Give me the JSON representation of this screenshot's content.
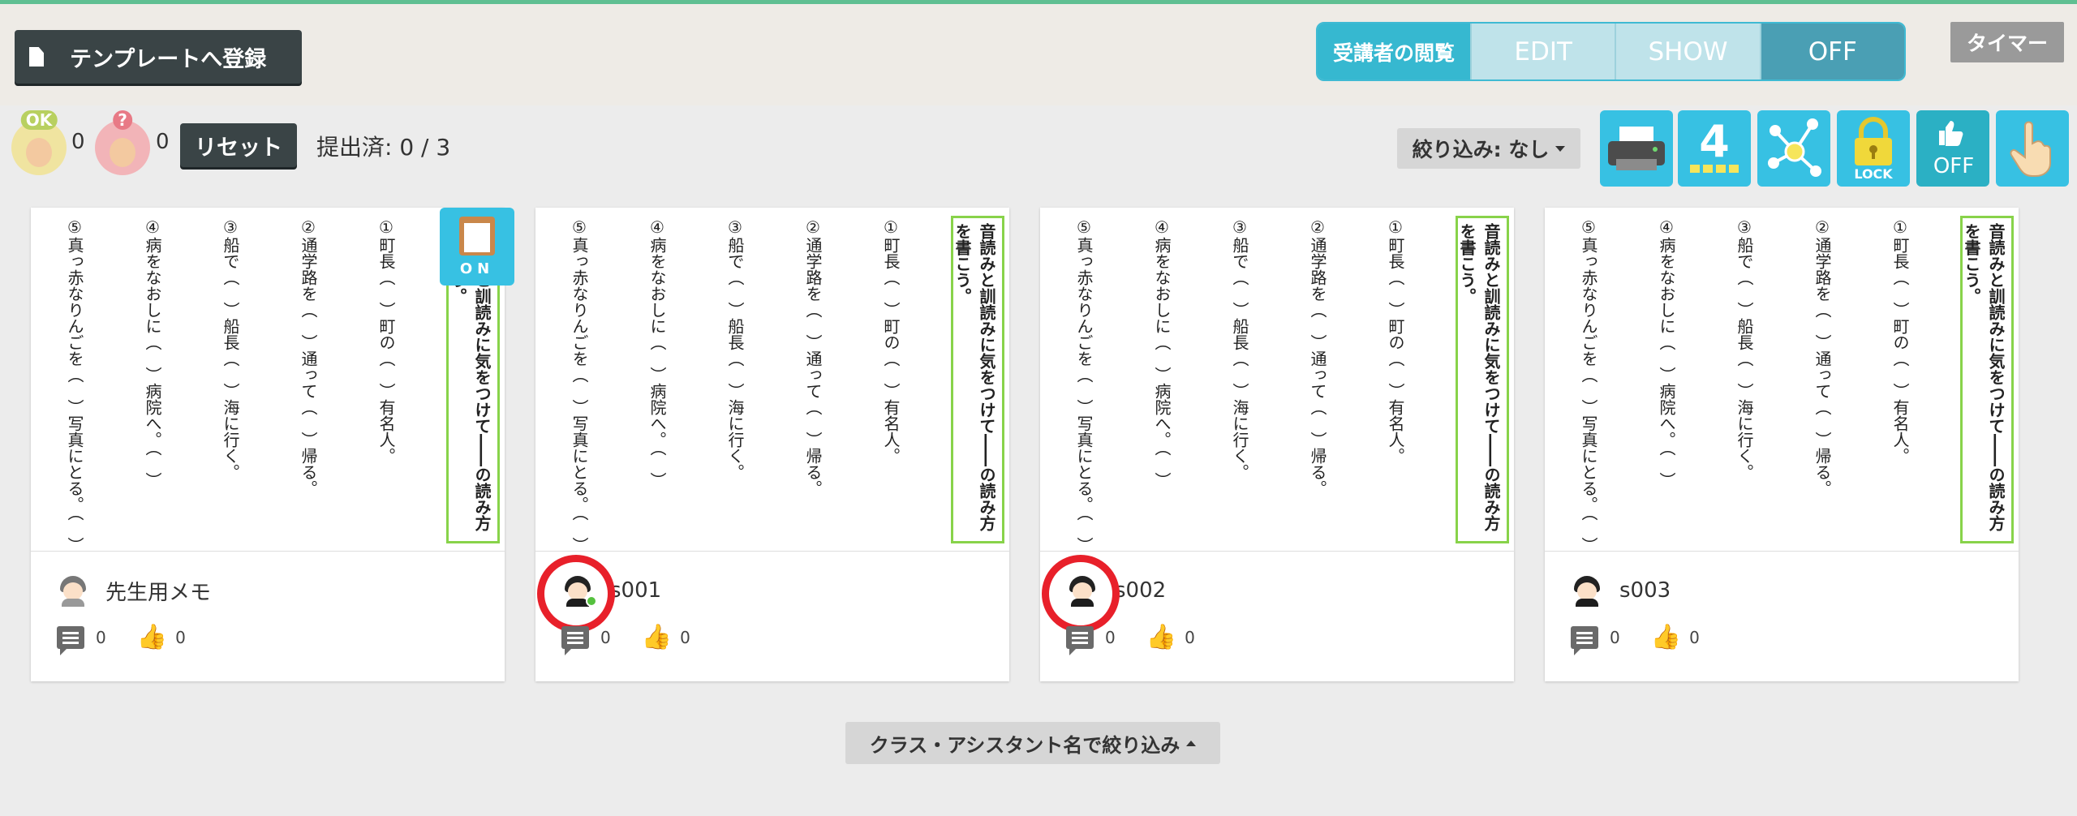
{
  "header": {
    "template_button": "テンプレートへ登録",
    "viewer_label": "受講者の閲覧",
    "view_modes": [
      "EDIT",
      "SHOW",
      "OFF"
    ],
    "selected_mode": "OFF",
    "timer": "タイマー"
  },
  "status": {
    "ok_tag": "OK",
    "ok_count": "0",
    "ng_tag": "?",
    "ng_count": "0",
    "reset": "リセット",
    "submitted": "提出済: 0 / 3",
    "filter": "絞り込み: なし"
  },
  "toolbar": {
    "tools": [
      "printer-icon",
      "layout-4-icon",
      "network-icon",
      "lock-icon",
      "like-off-icon",
      "hand-pointer-icon"
    ],
    "four_label": "4",
    "lock_label": "LOCK",
    "off_label": "OFF"
  },
  "sheet": {
    "title": "音読みと訓読みに気をつけて――の読み方を書こう。",
    "questions": [
      {
        "num": "①",
        "text": "町長（　）町の（　）有名人。"
      },
      {
        "num": "②",
        "text": "通学路を（　）通って（　）帰る。"
      },
      {
        "num": "③",
        "text": "船で（　）船長（　）海に行く。"
      },
      {
        "num": "④",
        "text": "病をなおしに（　）病院へ。（　）"
      },
      {
        "num": "⑤",
        "text": "真っ赤なりんごを（　）写真にとる。（　）"
      }
    ]
  },
  "on_badge": "ON",
  "cards": [
    {
      "owner": "先生用メモ",
      "comments": "0",
      "likes": "0",
      "type": "teacher"
    },
    {
      "owner": "s001",
      "comments": "0",
      "likes": "0",
      "type": "student"
    },
    {
      "owner": "s002",
      "comments": "0",
      "likes": "0",
      "type": "student"
    },
    {
      "owner": "s003",
      "comments": "0",
      "likes": "0",
      "type": "student"
    }
  ],
  "class_filter": "クラス・アシスタント名で絞り込み"
}
